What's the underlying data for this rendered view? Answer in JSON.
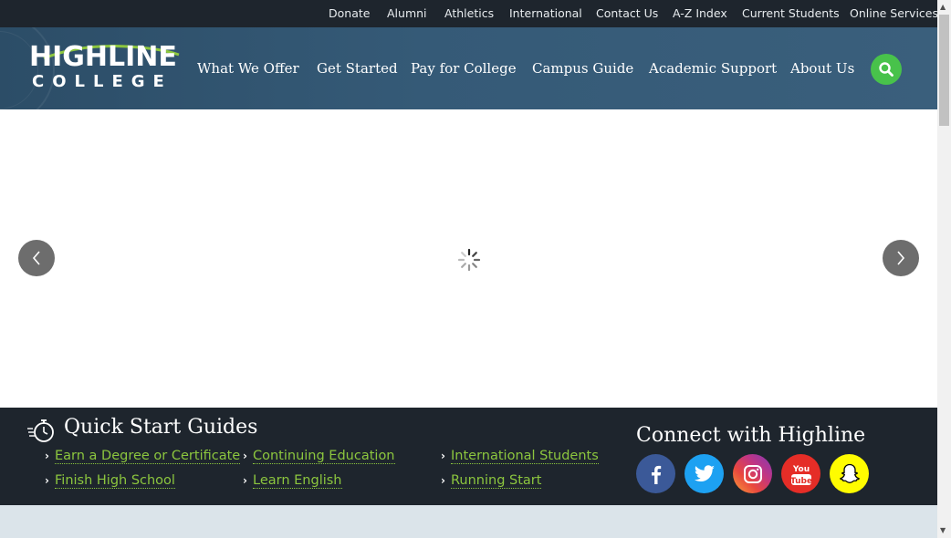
{
  "utility_nav": {
    "items": [
      {
        "label": "Donate"
      },
      {
        "label": "Alumni"
      },
      {
        "label": "Athletics"
      },
      {
        "label": "International"
      },
      {
        "label": "Contact Us"
      },
      {
        "label": "A-Z Index"
      },
      {
        "label": "Current Students"
      },
      {
        "label": "Online Services"
      }
    ]
  },
  "logo": {
    "line1": "HIGHLINE",
    "line2": "COLLEGE"
  },
  "main_nav": {
    "items": [
      {
        "label": "What We Offer"
      },
      {
        "label": "Get Started"
      },
      {
        "label": "Pay for College"
      },
      {
        "label": "Campus Guide"
      },
      {
        "label": "Academic Support"
      },
      {
        "label": "About Us"
      }
    ],
    "search_icon": "search-icon"
  },
  "carousel": {
    "prev_icon": "chevron-left-icon",
    "next_icon": "chevron-right-icon",
    "loading_icon": "spinner-icon"
  },
  "quick_start": {
    "title": "Quick Start Guides",
    "icon": "stopwatch-icon",
    "links": [
      {
        "label": "Earn a Degree or Certificate"
      },
      {
        "label": "Continuing Education"
      },
      {
        "label": "International Students"
      },
      {
        "label": "Finish High School"
      },
      {
        "label": "Learn English"
      },
      {
        "label": "Running Start"
      }
    ]
  },
  "connect": {
    "title": "Connect with Highline",
    "networks": [
      {
        "name": "facebook-icon",
        "color": "#3b5998"
      },
      {
        "name": "twitter-icon",
        "color": "#1da1f2"
      },
      {
        "name": "instagram-icon",
        "color": "#c13584"
      },
      {
        "name": "youtube-icon",
        "color": "#e52d27",
        "text": "You Tube"
      },
      {
        "name": "snapchat-icon",
        "color": "#fffc00"
      }
    ]
  },
  "colors": {
    "utility_bg": "#1e252d",
    "header_bg": "#355a77",
    "accent_green": "#48c24b",
    "link_green": "#8cc63e"
  }
}
